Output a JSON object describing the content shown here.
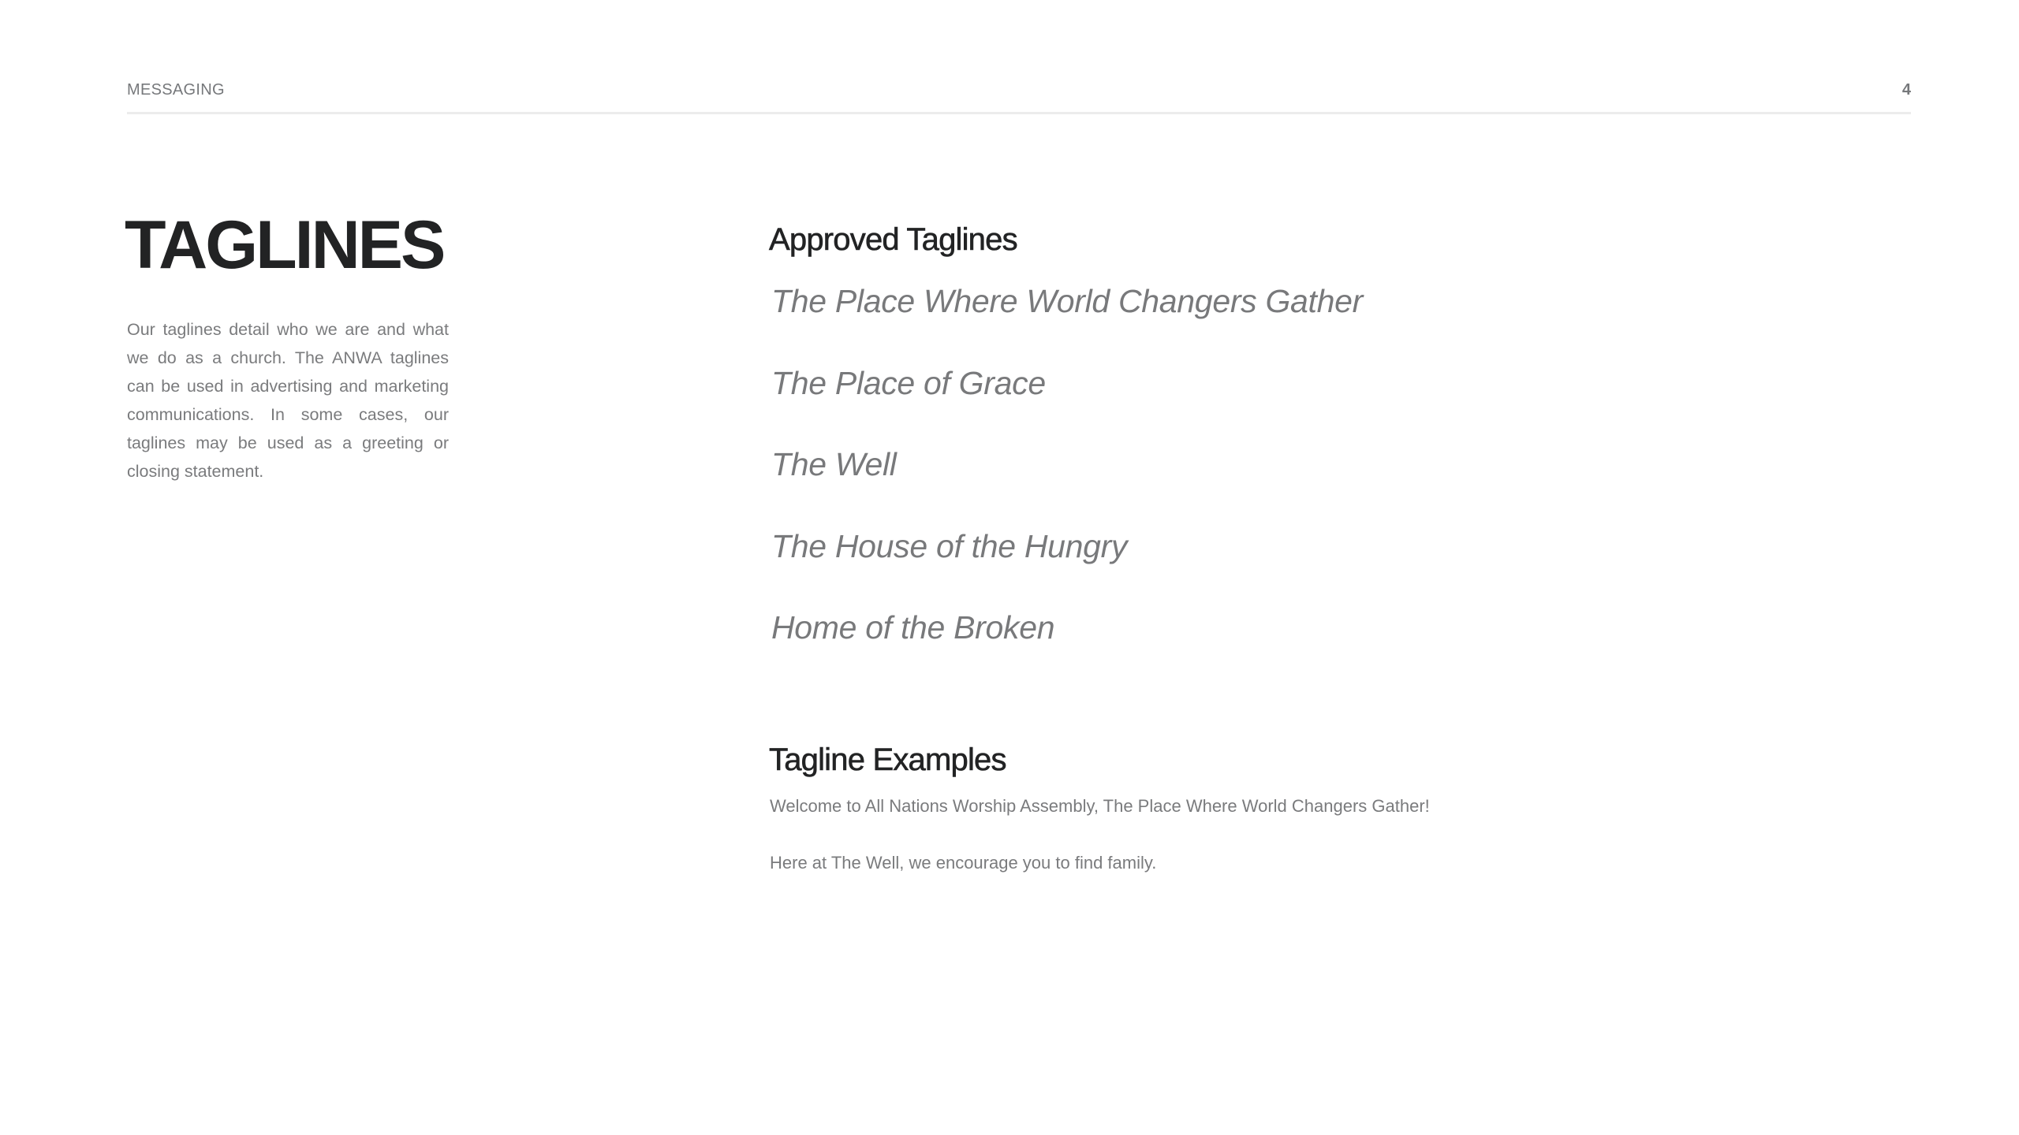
{
  "header": {
    "section_label": "MESSAGING",
    "page_number": "4"
  },
  "left": {
    "title": "TAGLINES",
    "intro": "Our taglines detail who we are and what we do as a church. The ANWA taglines can be used in advertising and marketing communications. In some cases, our taglines may be used as a greeting or closing statement."
  },
  "approved": {
    "heading": "Approved Taglines",
    "taglines": [
      "The Place Where World Changers Gather",
      "The Place of Grace",
      "The Well",
      "The House of the Hungry",
      "Home of the Broken"
    ]
  },
  "examples": {
    "heading": "Tagline Examples",
    "items": [
      "Welcome to All Nations Worship Assembly, The Place Where World Changers Gather!",
      "Here at The Well, we encourage you to find family."
    ]
  }
}
